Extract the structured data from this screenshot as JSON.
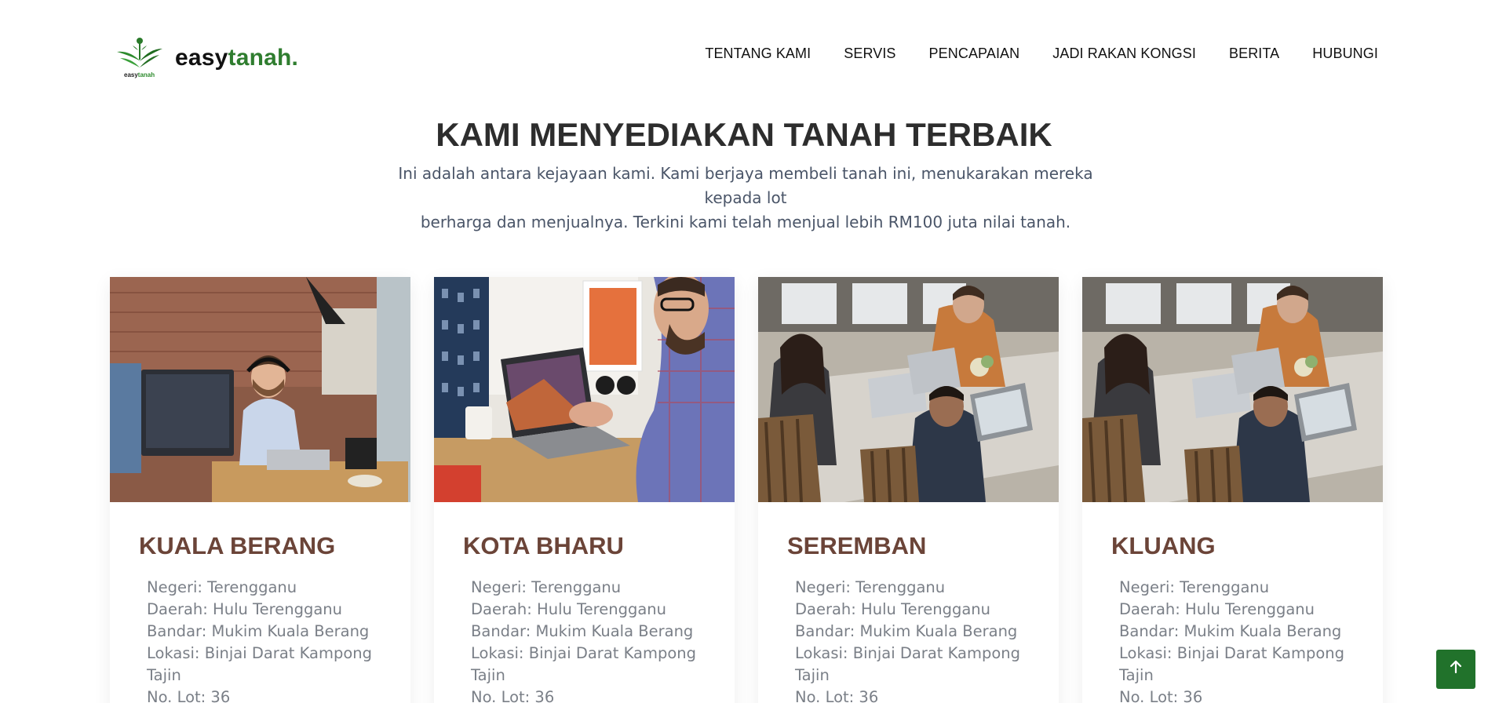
{
  "header": {
    "logo_caption_a": "easy",
    "logo_caption_b": "tanah",
    "logo_text_a": "easy",
    "logo_text_b": "tanah."
  },
  "nav": [
    {
      "label": "TENTANG KAMI"
    },
    {
      "label": "SERVIS"
    },
    {
      "label": "PENCAPAIAN"
    },
    {
      "label": "JADI RAKAN KONGSI"
    },
    {
      "label": "BERITA"
    },
    {
      "label": "HUBUNGI"
    }
  ],
  "hero": {
    "title": "KAMI MENYEDIAKAN TANAH TERBAIK",
    "subtitle_line1": "Ini adalah antara kejayaan kami. Kami berjaya membeli tanah ini, menukarakan mereka kepada lot",
    "subtitle_line2": "berharga dan menjualnya. Terkini kami telah menjual lebih RM100 juta nilai tanah."
  },
  "cards": [
    {
      "title": "KUALA BERANG",
      "negeri": "Negeri: Terengganu",
      "daerah": "Daerah: Hulu Terengganu",
      "bandar": "Bandar: Mukim Kuala Berang",
      "lokasi": "Lokasi: Binjai Darat Kampong Tajin",
      "lot": "No. Lot: 36"
    },
    {
      "title": "KOTA BHARU",
      "negeri": "Negeri: Terengganu",
      "daerah": "Daerah: Hulu Terengganu",
      "bandar": "Bandar: Mukim Kuala Berang",
      "lokasi": "Lokasi: Binjai Darat Kampong Tajin",
      "lot": "No. Lot: 36"
    },
    {
      "title": "SEREMBAN",
      "negeri": "Negeri: Terengganu",
      "daerah": "Daerah: Hulu Terengganu",
      "bandar": "Bandar: Mukim Kuala Berang",
      "lokasi": "Lokasi: Binjai Darat Kampong Tajin",
      "lot": "No. Lot: 36"
    },
    {
      "title": "KLUANG",
      "negeri": "Negeri: Terengganu",
      "daerah": "Daerah: Hulu Terengganu",
      "bandar": "Bandar: Mukim Kuala Berang",
      "lokasi": "Lokasi: Binjai Darat Kampong Tajin",
      "lot": "No. Lot: 36"
    }
  ],
  "icons": {
    "back_to_top": "arrow-up-icon",
    "logo": "easytanah-logo-icon"
  },
  "colors": {
    "brand_green": "#2f7d2f",
    "card_title": "#6b4438",
    "back_to_top_bg": "#21722b"
  }
}
